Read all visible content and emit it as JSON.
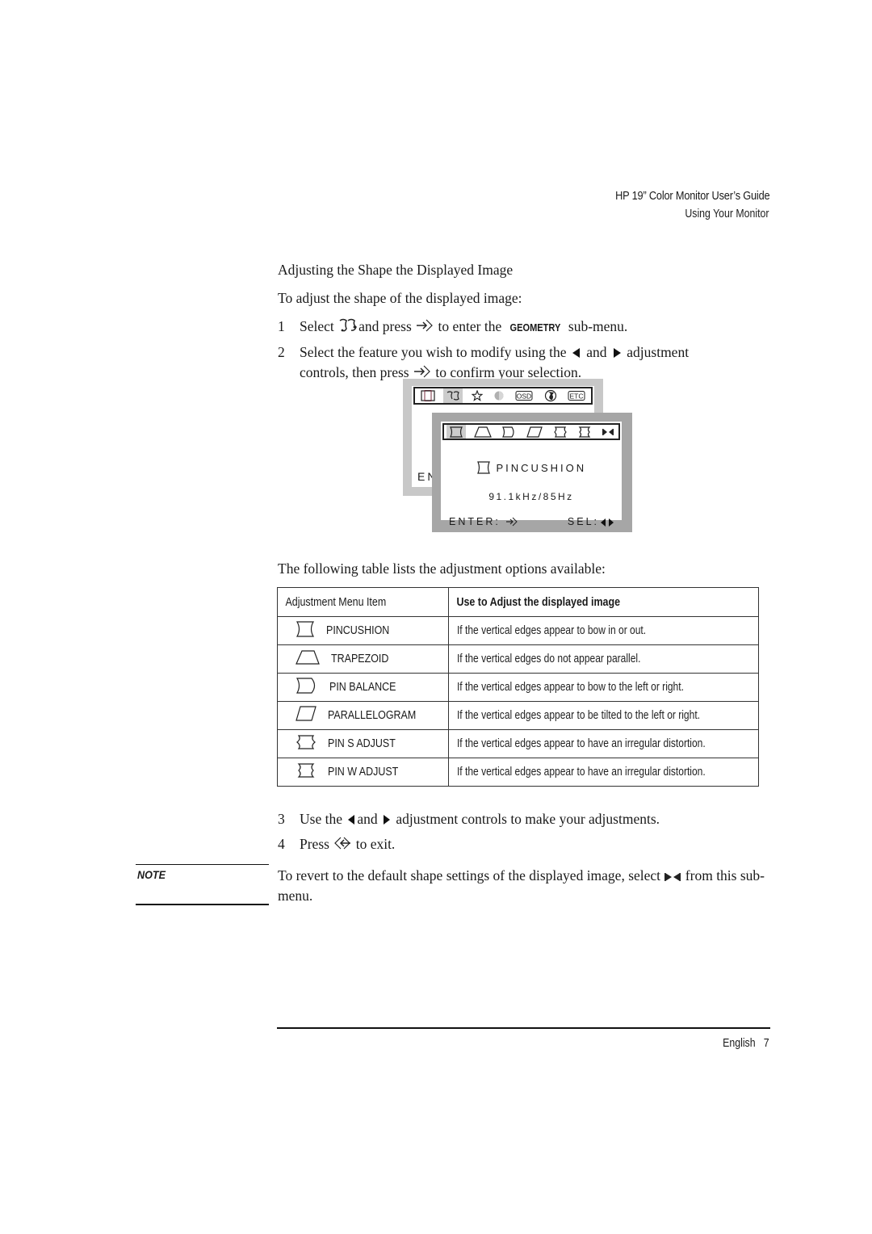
{
  "header": {
    "title": "HP 19” Color Monitor User’s Guide",
    "subtitle": "Using Your Monitor"
  },
  "section": {
    "title": "Adjusting the Shape the Displayed Image",
    "intro": "To adjust the shape of the displayed image:"
  },
  "steps": [
    {
      "num": "1",
      "parts": [
        "Select",
        "and press",
        "to enter the",
        "GEOMETRY",
        "sub-menu."
      ],
      "icons": [
        "geometry-icon",
        "enter-icon"
      ]
    },
    {
      "num": "2",
      "parts": [
        "Select the feature you wish to modify using the",
        "and",
        "adjustment",
        "controls, then press",
        "to confirm your selection."
      ],
      "icons": [
        "left-arrow-icon",
        "right-arrow-icon",
        "enter-icon"
      ]
    },
    {
      "num": "3",
      "parts": [
        "Use the",
        "and",
        "adjustment controls to make your adjustments."
      ],
      "icons": [
        "left-arrow-icon",
        "right-arrow-icon"
      ]
    },
    {
      "num": "4",
      "parts": [
        "Press",
        "to exit."
      ],
      "icons": [
        "exit-icon"
      ]
    }
  ],
  "osd": {
    "back_menu_icons": [
      "size-position-icon",
      "geometry-icon",
      "brightness-icon",
      "color-icon",
      "osd-icon",
      "language-icon",
      "etc-icon"
    ],
    "back_menu_selected": 1,
    "back_partial_text": "EN",
    "back_osd_label": "OSD",
    "back_etc_label": "ETC",
    "front_menu_icons": [
      "pincushion-icon",
      "trapezoid-icon",
      "pin-balance-icon",
      "parallelogram-icon",
      "pin-s-adjust-icon",
      "pin-w-adjust-icon",
      "reset-icon"
    ],
    "front_menu_selected": 0,
    "item_label": "PINCUSHION",
    "frequency": "91.1kHz/85Hz",
    "enter_label": "ENTER:",
    "sel_label": "SEL:"
  },
  "table_intro": "The following table lists the adjustment options available:",
  "table": {
    "headers": [
      "Adjustment Menu Item",
      "Use to Adjust the displayed image"
    ],
    "rows": [
      {
        "icon": "pincushion-icon",
        "item": "PINCUSHION",
        "use": "If the vertical edges appear to bow in or out."
      },
      {
        "icon": "trapezoid-icon",
        "item": "TRAPEZOID",
        "use": "If the vertical edges do not appear parallel."
      },
      {
        "icon": "pin-balance-icon",
        "item": "PIN BALANCE",
        "use": "If the vertical edges appear to bow to the left or right."
      },
      {
        "icon": "parallelogram-icon",
        "item": "PARALLELOGRAM",
        "use": "If the vertical edges appear to be tilted to the left or right."
      },
      {
        "icon": "pin-s-adjust-icon",
        "item": "PIN S ADJUST",
        "use": "If the vertical edges appear to have an irregular distortion."
      },
      {
        "icon": "pin-w-adjust-icon",
        "item": "PIN W ADJUST",
        "use": "If the vertical edges appear to have an irregular distortion."
      }
    ]
  },
  "note": {
    "label": "NOTE",
    "text_before": "To revert to the default shape settings of the displayed image, select",
    "text_after": "from this sub-menu.",
    "icon": "reset-icon"
  },
  "footer": {
    "language": "English",
    "page": "7"
  }
}
